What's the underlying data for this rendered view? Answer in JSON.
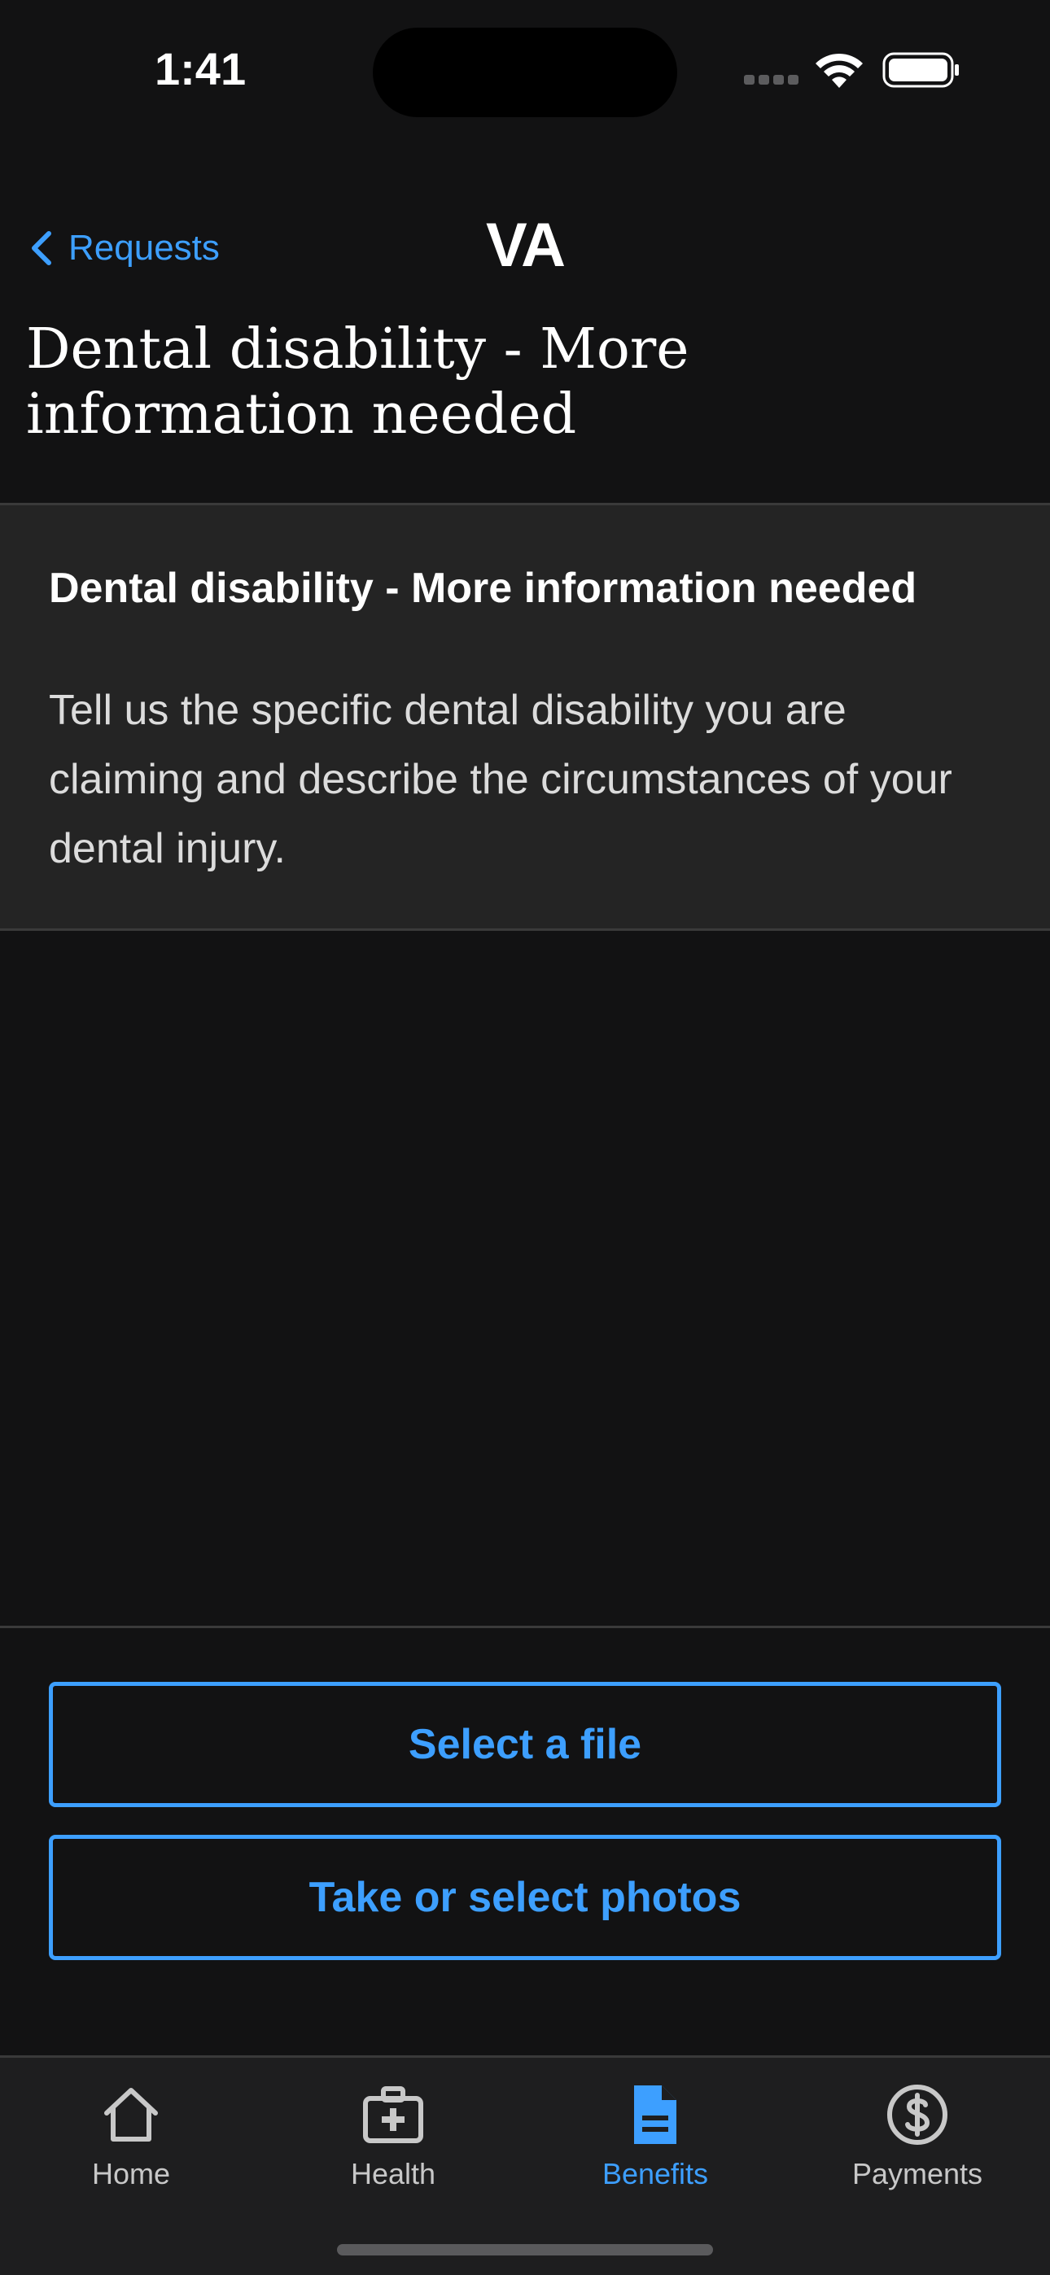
{
  "status_bar": {
    "time": "1:41"
  },
  "nav": {
    "back_label": "Requests",
    "logo_text": "VA"
  },
  "page": {
    "title": "Dental disability - More information needed"
  },
  "request_card": {
    "heading": "Dental disability - More information needed",
    "body": "Tell us the specific dental disability you are claiming and describe the circumstances of your dental injury."
  },
  "actions": {
    "select_file_label": "Select a file",
    "take_photos_label": "Take or select photos"
  },
  "tab_bar": {
    "items": [
      {
        "label": "Home",
        "icon": "home-icon"
      },
      {
        "label": "Health",
        "icon": "medical-bag-icon"
      },
      {
        "label": "Benefits",
        "icon": "document-icon",
        "active": true
      },
      {
        "label": "Payments",
        "icon": "dollar-icon"
      }
    ]
  },
  "colors": {
    "background": "#121213",
    "card": "#242424",
    "accent": "#3d9fff",
    "text": "#ffffff"
  }
}
